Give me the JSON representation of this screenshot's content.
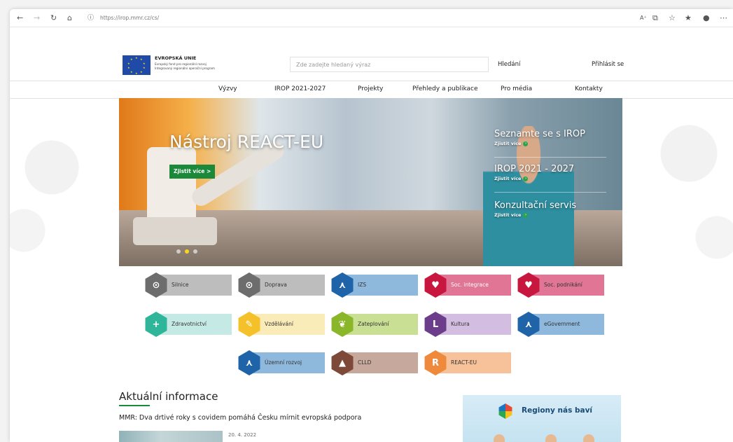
{
  "browser": {
    "url": "https://irop.mmr.cz/cs/",
    "icons": [
      "back-icon",
      "forward-icon",
      "refresh-icon",
      "home-icon",
      "info-icon",
      "read-aloud-icon",
      "tab-icon",
      "split-icon",
      "favorites-icon",
      "profile-icon",
      "more-icon"
    ]
  },
  "header": {
    "eu_title": "EVROPSKÁ UNIE",
    "eu_sub1": "Evropský fond pro regionální rozvoj",
    "eu_sub2": "Integrovaný regionální operační program",
    "search_placeholder": "Zde zadejte hledaný výraz",
    "search_label": "Hledání",
    "login_label": "Přihlásit se"
  },
  "nav": {
    "items": [
      {
        "label": "Výzvy"
      },
      {
        "label": "IROP 2021-2027"
      },
      {
        "label": "Projekty"
      },
      {
        "label": "Přehledy a publikace"
      },
      {
        "label": "Pro média"
      },
      {
        "label": "Kontakty"
      }
    ]
  },
  "hero": {
    "title": "Nástroj REACT-EU",
    "button": "Zjistit více  >",
    "side": [
      {
        "title": "Seznamte se s IROP",
        "more": "Zjistit více"
      },
      {
        "title": "IROP 2021 - 2027",
        "more": "Zjistit více"
      },
      {
        "title": "Konzultační servis",
        "more": "Zjistit více"
      }
    ],
    "slides": 3,
    "active_slide": 1
  },
  "categories": [
    {
      "label": "Silnice",
      "hex": "#6d6d6d",
      "bar": "#bdbdbd",
      "glyph": "⊙",
      "dark": true
    },
    {
      "label": "Doprava",
      "hex": "#6d6d6d",
      "bar": "#bdbdbd",
      "glyph": "⊙",
      "dark": true
    },
    {
      "label": "IZS",
      "hex": "#1f63a8",
      "bar": "#8fb8dd",
      "glyph": "⋏",
      "dark": true
    },
    {
      "label": "Soc. integrace",
      "hex": "#c8173f",
      "bar": "#e07596",
      "glyph": "♥",
      "dark": false
    },
    {
      "label": "Soc. podnikání",
      "hex": "#c8173f",
      "bar": "#e07596",
      "glyph": "♥",
      "dark": true
    },
    {
      "label": "Zdravotnictví",
      "hex": "#2fb59a",
      "bar": "#c5eae5",
      "glyph": "+",
      "dark": true
    },
    {
      "label": "Vzdělávání",
      "hex": "#f5c12a",
      "bar": "#faecb8",
      "glyph": "✎",
      "dark": true
    },
    {
      "label": "Zateplování",
      "hex": "#8ab62a",
      "bar": "#c9df93",
      "glyph": "❦",
      "dark": true
    },
    {
      "label": "Kultura",
      "hex": "#6b3d8a",
      "bar": "#d3bde0",
      "glyph": "L",
      "dark": true
    },
    {
      "label": "eGovernment",
      "hex": "#1f63a8",
      "bar": "#8fb8dd",
      "glyph": "⋏",
      "dark": true
    },
    {
      "label": "Územní rozvoj",
      "hex": "#1f63a8",
      "bar": "#8fb8dd",
      "glyph": "⋏",
      "dark": true
    },
    {
      "label": "CLLD",
      "hex": "#7d4a3a",
      "bar": "#c6a89c",
      "glyph": "▲",
      "dark": true
    },
    {
      "label": "REACT-EU",
      "hex": "#ef8a3c",
      "bar": "#f7c299",
      "glyph": "R",
      "dark": true
    }
  ],
  "news": {
    "title": "Aktuální informace",
    "headline": "MMR: Dva drtivé roky s covidem pomáhá Česku mírnit evropská podpora",
    "date": "20. 4. 2022"
  },
  "promo": {
    "title": "Regiony nás baví"
  },
  "colors": {
    "accent_green": "#1a8a3a",
    "eu_blue": "#1f4aa8"
  }
}
